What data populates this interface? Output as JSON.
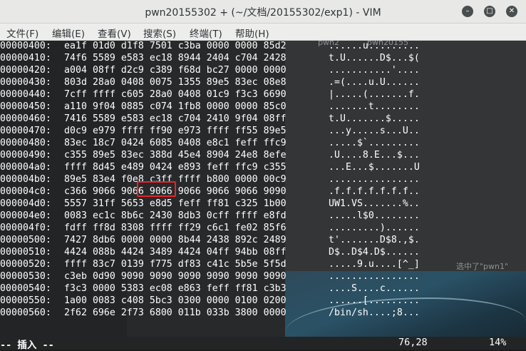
{
  "window": {
    "title": "pwn20155302 + (~/文档/20155302/exp1) - VIM",
    "minimize_glyph": "–",
    "maximize_glyph": "□",
    "close_glyph": "✕"
  },
  "menu": [
    {
      "label": "文件(F)"
    },
    {
      "label": "编辑(E)"
    },
    {
      "label": "查看(V)"
    },
    {
      "label": "搜索(S)"
    },
    {
      "label": "终端(T)"
    },
    {
      "label": "帮助(H)"
    }
  ],
  "background_labels": {
    "top_left": "pwn2",
    "top_right": "pwn20155",
    "right": "选中了\"pwn1\""
  },
  "hexdump": [
    {
      "addr": "00000400:",
      "hex": "ea1f 01d0 d1f8 7501 c3ba 0000 0000 85d2",
      "ascii": "......u........."
    },
    {
      "addr": "00000410:",
      "hex": "74f6 5589 e583 ec18 8944 2404 c704 2428",
      "ascii": "t.U......D$...$("
    },
    {
      "addr": "00000420:",
      "hex": "a004 08ff d2c9 c389 f68d bc27 0000 0000",
      "ascii": "...........'...."
    },
    {
      "addr": "00000430:",
      "hex": "803d 28a0 0408 0075 1355 89e5 83ec 08e8",
      "ascii": ".=(....u.U......"
    },
    {
      "addr": "00000440:",
      "hex": "7cff ffff c605 28a0 0408 01c9 f3c3 6690",
      "ascii": "|.....(.......f."
    },
    {
      "addr": "00000450:",
      "hex": "a110 9f04 0885 c074 1fb8 0000 0000 85c0",
      "ascii": ".......t........"
    },
    {
      "addr": "00000460:",
      "hex": "7416 5589 e583 ec18 c704 2410 9f04 08ff",
      "ascii": "t.U.......$....."
    },
    {
      "addr": "00000470:",
      "hex": "d0c9 e979 ffff ff90 e973 ffff ff55 89e5",
      "ascii": "...y.....s...U.."
    },
    {
      "addr": "00000480:",
      "hex": "83ec 18c7 0424 6085 0408 e8c1 feff ffc9",
      "ascii": ".....$`........."
    },
    {
      "addr": "00000490:",
      "hex": "c355 89e5 83ec 388d 45e4 8904 24e8 8efe",
      "ascii": ".U....8.E...$..."
    },
    {
      "addr": "000004a0:",
      "hex": "ffff 8d45 e489 0424 e893 feff ffc9 c355",
      "ascii": "...E...$.......U"
    },
    {
      "addr": "000004b0:",
      "hex": "89e5 83e4 f0e8 c3ff ffff b800 0000 00c9",
      "ascii": "................"
    },
    {
      "addr": "000004c0:",
      "hex": "c366 9066 9066 9066 9066 9066 9066 9090",
      "ascii": ".f.f.f.f.f.f.f.."
    },
    {
      "addr": "000004d0:",
      "hex": "5557 31ff 5653 e8d5 feff ff81 c325 1b00",
      "ascii": "UW1.VS.......%.."
    },
    {
      "addr": "000004e0:",
      "hex": "0083 ec1c 8b6c 2430 8db3 0cff ffff e8fd",
      "ascii": ".....l$0........"
    },
    {
      "addr": "000004f0:",
      "hex": "fdff ff8d 8308 ffff ff29 c6c1 fe02 85f6",
      "ascii": ".........)......"
    },
    {
      "addr": "00000500:",
      "hex": "7427 8db6 0000 0000 8b44 2438 892c 2489",
      "ascii": "t'.......D$8.,$."
    },
    {
      "addr": "00000510:",
      "hex": "4424 088b 4424 3489 4424 04ff 94bb 08ff",
      "ascii": "D$..D$4.D$......"
    },
    {
      "addr": "00000520:",
      "hex": "ffff 83c7 0139 f775 df83 c41c 5b5e 5f5d",
      "ascii": ".....9.u....[^_]"
    },
    {
      "addr": "00000530:",
      "hex": "c3eb 0d90 9090 9090 9090 9090 9090 9090",
      "ascii": "................"
    },
    {
      "addr": "00000540:",
      "hex": "f3c3 0000 5383 ec08 e863 feff ff81 c3b3",
      "ascii": "....S....c......"
    },
    {
      "addr": "00000550:",
      "hex": "1a00 0083 c408 5bc3 0300 0000 0100 0200",
      "ascii": "......[........."
    },
    {
      "addr": "00000560:",
      "hex": "2f62 696e 2f73 6800 011b 033b 3800 0000",
      "ascii": "/bin/sh....;8..."
    }
  ],
  "status": {
    "mode": "-- 插入 --",
    "cursor": "76,28",
    "percent": "14%"
  },
  "colors": {
    "terminal_bg": "#222426",
    "text": "#ffffff",
    "highlight_box": "#e8232a"
  }
}
